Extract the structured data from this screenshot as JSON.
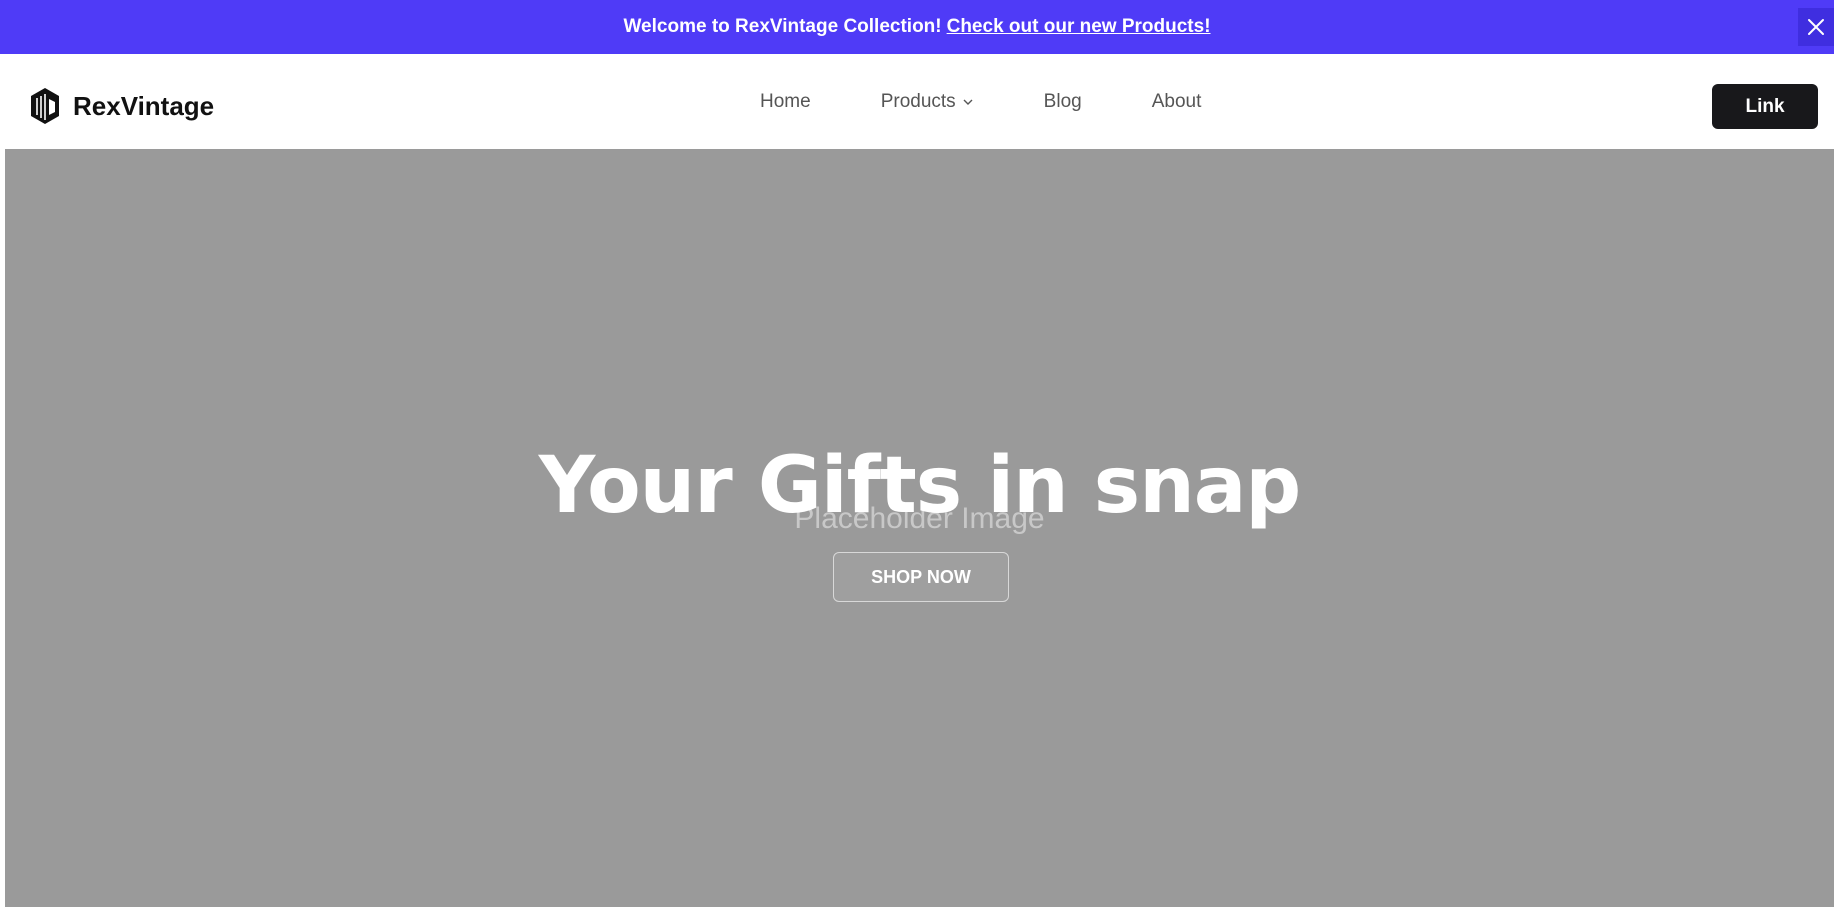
{
  "announcement": {
    "message": "Welcome to RexVintage Collection!",
    "link_text": "Check out our new Products!",
    "close_icon": "close-icon",
    "background": "#4f3bf7"
  },
  "header": {
    "brand_name": "RexVintage",
    "logo_icon": "rexvintage-logo",
    "nav": [
      {
        "label": "Home"
      },
      {
        "label": "Products",
        "icon": "chevron-down-icon"
      },
      {
        "label": "Blog"
      },
      {
        "label": "About"
      }
    ],
    "cta_label": "Link"
  },
  "hero": {
    "headline": "Your Gifts in snap",
    "placeholder_text": "Placeholder Image",
    "button_label": "SHOP NOW",
    "background": "#9a9a9a"
  }
}
